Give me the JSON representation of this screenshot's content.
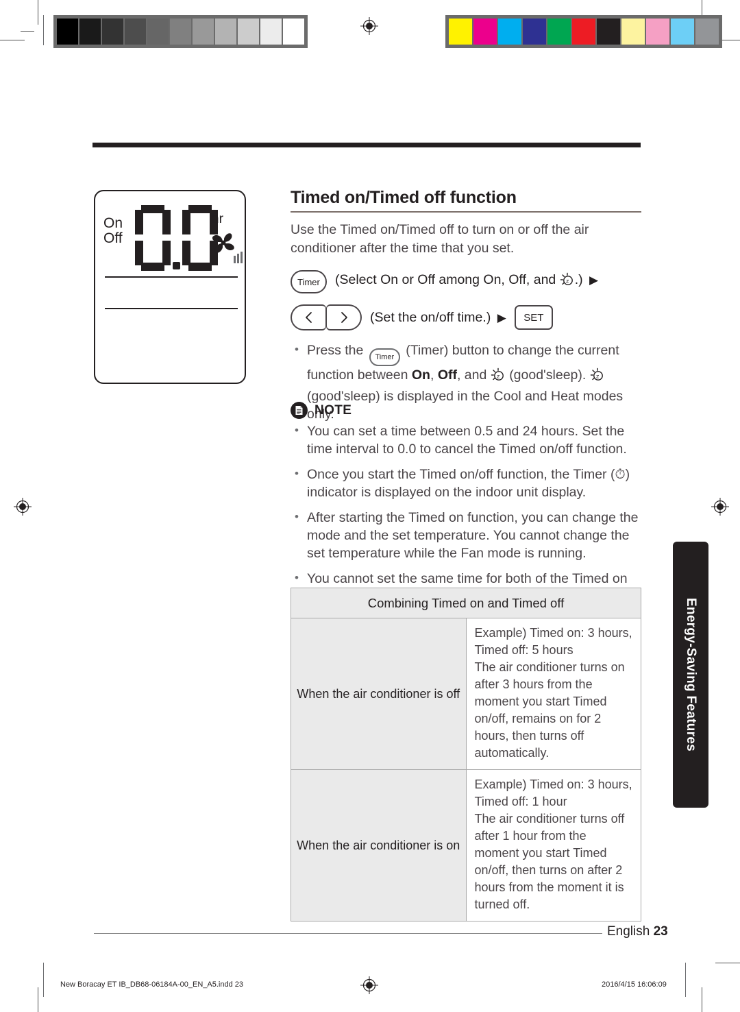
{
  "print_marks": {
    "gray_swatches": [
      "#000000",
      "#1a1a1a",
      "#333333",
      "#4d4d4d",
      "#666666",
      "#808080",
      "#999999",
      "#b3b3b3",
      "#cccccc",
      "#ececec",
      "#ffffff"
    ],
    "color_swatches": [
      "#fff200",
      "#ec008c",
      "#00aeef",
      "#2e3192",
      "#00a651",
      "#ed1c24",
      "#231f20",
      "#fdf3a0",
      "#f5a0c4",
      "#6dcff6",
      "#939598"
    ],
    "registration_icon": "registration-target-icon"
  },
  "lcd": {
    "on_label": "On",
    "off_label": "Off",
    "value": "0.0",
    "unit": "hr",
    "fan_icon": "fan-icon",
    "fan_speed_bars": 3
  },
  "heading": "Timed on/Timed off function",
  "intro": "Use the Timed on/Timed off to turn on or off the air conditioner after the time that you set.",
  "steps": [
    {
      "button": "Timer",
      "button_icon": "timer-button",
      "text_before": "(Select On or Off among On, Off, and",
      "inline_icon": "goodsleep-icon",
      "text_after": ".)",
      "arrow": "▶"
    },
    {
      "left_button_icon": "chevron-left-icon",
      "left_button_label": "‹",
      "right_button_icon": "chevron-right-icon",
      "right_button_label": "›",
      "text": "(Set the on/off time.)",
      "arrow": "▶",
      "set_button_label": "SET"
    }
  ],
  "press_bullet": {
    "part1": "Press the",
    "timer_button": "Timer",
    "part2": "(Timer) button to change the current function between",
    "on": "On",
    "comma": ",",
    "off": "Off",
    "part3": ", and",
    "goodsleep1": "goodsleep-icon",
    "part4": "(good'sleep).",
    "goodsleep2": "goodsleep-icon",
    "part5": "(good'sleep) is displayed in the Cool and Heat modes only."
  },
  "note": {
    "icon": "note-document-icon",
    "label": "NOTE",
    "items": [
      "You can set a time between 0.5 and 24 hours. Set the time interval to 0.0 to cancel the Timed on/off function.",
      "Once you start the Timed on/off function, the Timer (⏱) indicator is displayed on the indoor unit display.",
      "After starting the Timed on function, you can change the mode and the set temperature. You cannot change the set temperature while the Fan mode is running.",
      "You cannot set the same time for both of the Timed on and Timed off functions."
    ]
  },
  "table": {
    "header": "Combining Timed on and Timed off",
    "rows": [
      {
        "label": "When the air conditioner is off",
        "example": "Example) Timed on: 3 hours, Timed off: 5 hours",
        "detail": "The air conditioner turns on after 3 hours from the moment you start Timed on/off, remains on for 2 hours, then turns off automatically."
      },
      {
        "label": "When the air conditioner is on",
        "example": "Example) Timed on: 3 hours, Timed off: 1 hour",
        "detail": "The air conditioner turns off after 1 hour from the moment you start Timed on/off, then turns on after 2 hours from the moment it is turned off."
      }
    ]
  },
  "side_tab": "Energy-Saving Features",
  "footer": {
    "language": "English",
    "page_number": "23",
    "imprint_left": "New Boracay ET IB_DB68-06184A-00_EN_A5.indd   23",
    "imprint_right": "2016/4/15   16:06:09"
  }
}
